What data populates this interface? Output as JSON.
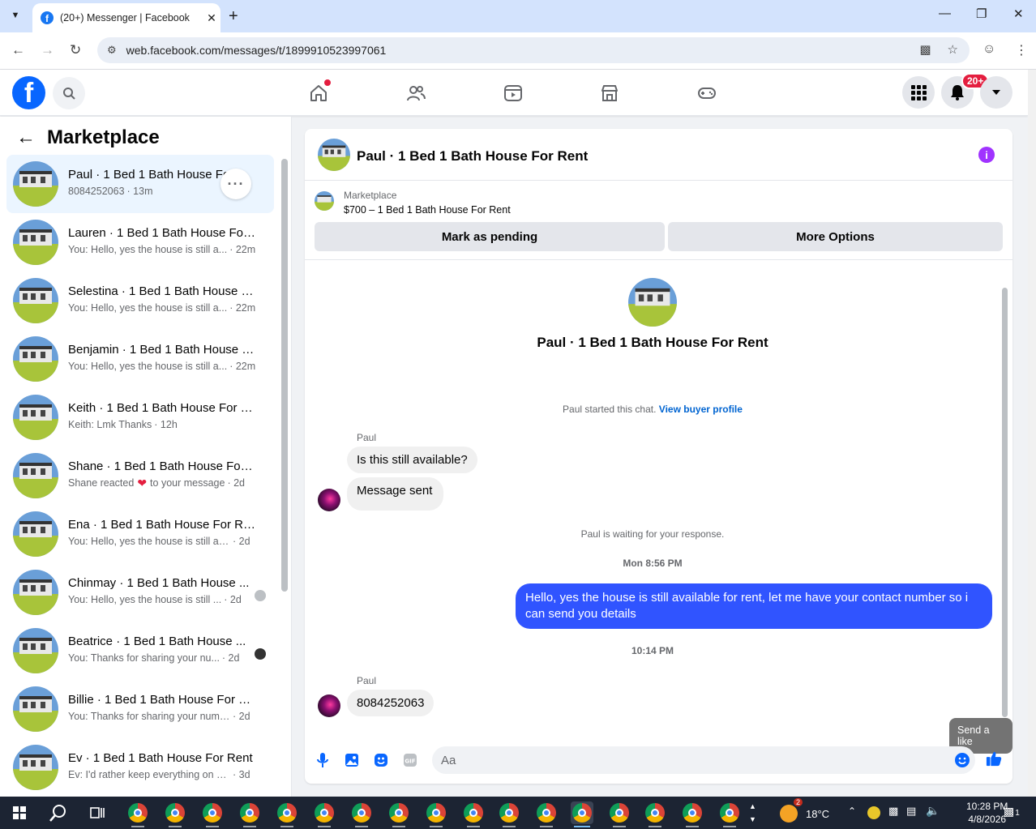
{
  "browser": {
    "tab_title": "(20+) Messenger | Facebook",
    "url": "web.facebook.com/messages/t/1899910523997061"
  },
  "header": {
    "notification_badge": "20+"
  },
  "left_panel": {
    "title": "Marketplace",
    "conversations": [
      {
        "name": "Paul · 1 Bed 1 Bath House For Rent",
        "preview": "8084252063",
        "time": "· 13m",
        "active": true
      },
      {
        "name": "Lauren · 1 Bed 1 Bath House For ...",
        "preview": "You: Hello, yes the house is still a...",
        "time": "· 22m"
      },
      {
        "name": "Selestina · 1 Bed 1 Bath House F...",
        "preview": "You: Hello, yes the house is still a...",
        "time": "· 22m"
      },
      {
        "name": "Benjamin · 1 Bed 1 Bath House F...",
        "preview": "You: Hello, yes the house is still a...",
        "time": "· 22m"
      },
      {
        "name": "Keith · 1 Bed 1 Bath House For R...",
        "preview": "Keith: Lmk Thanks",
        "time": "· 12h"
      },
      {
        "name": "Shane · 1 Bed 1 Bath House For ...",
        "preview": "Shane reacted",
        "preview_after": "to your message",
        "time": "· 2d"
      },
      {
        "name": "Ena · 1 Bed 1 Bath House For Rent",
        "preview": "You: Hello, yes the house is still ava...",
        "time": "· 2d"
      },
      {
        "name": "Chinmay · 1 Bed 1 Bath House ...",
        "preview": "You: Hello, yes the house is still ...",
        "time": "· 2d"
      },
      {
        "name": "Beatrice · 1 Bed 1 Bath House ...",
        "preview": "You: Thanks for sharing your nu...",
        "time": "· 2d"
      },
      {
        "name": "Billie · 1 Bed 1 Bath House For Re...",
        "preview": "You: Thanks for sharing your numb...",
        "time": "· 2d"
      },
      {
        "name": "Ev · 1 Bed 1 Bath House For Rent",
        "preview": "Ev: I'd rather keep everything on h...",
        "time": "· 3d"
      }
    ]
  },
  "chat": {
    "title": "Paul · 1 Bed 1 Bath House For Rent",
    "listing_label": "Marketplace",
    "listing_item": "$700 – 1 Bed 1 Bath House For Rent",
    "btn_pending": "Mark as pending",
    "btn_more": "More Options",
    "intro_name": "Paul · 1 Bed 1 Bath House For Rent",
    "started_text": "Paul started this chat.",
    "view_profile": "View buyer profile",
    "sender1": "Paul",
    "msg1": "Is this still available?",
    "msg2": "Message sent",
    "waiting_text": "Paul is waiting for your response.",
    "ts1": "Mon 8:56 PM",
    "msg_out": "Hello, yes the house is still available for rent, let me have your contact number so i can send you  details",
    "ts2": "10:14 PM",
    "sender2": "Paul",
    "msg3": "8084252063",
    "tooltip": "Send a like",
    "input_placeholder": "Aa"
  },
  "taskbar": {
    "temperature": "18°C",
    "time": "10:28 PM",
    "date": "4/8/2026",
    "weather_badge": "2",
    "notif_count": "1"
  },
  "colors": {
    "fb_blue": "#0866ff",
    "outgoing_bubble": "#3054ff",
    "info_purple": "#a033ff",
    "badge_red": "#e41e3f"
  }
}
